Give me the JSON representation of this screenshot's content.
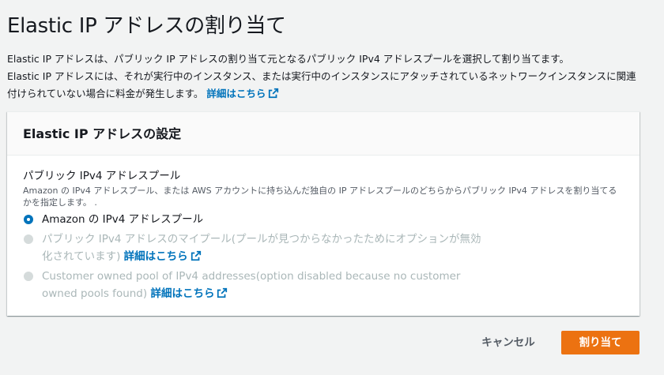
{
  "page": {
    "title": "Elastic IP アドレスの割り当て",
    "intro_line1": "Elastic IP アドレスは、パブリック IP アドレスの割り当て元となるパブリック IPv4 アドレスプールを選択して割り当てます。",
    "intro_line2": "Elastic IP アドレスには、それが実行中のインスタンス、または実行中のインスタンスにアタッチされているネットワークインスタンスに関連付けられていない場合に料金が発生します。",
    "learn_more": "詳細はこちら"
  },
  "panel": {
    "title": "Elastic IP アドレスの設定",
    "field_label": "パブリック IPv4 アドレスプール",
    "field_description": "Amazon の IPv4 アドレスプール、または AWS アカウントに持ち込んだ独自の IP アドレスプールのどちらからパブリック IPv4 アドレスを割り当てるかを指定します。 .",
    "options": [
      {
        "label": "Amazon の IPv4 アドレスプール",
        "selected": true,
        "disabled": false
      },
      {
        "label": "パブリック IPv4 アドレスのマイプール(プールが見つからなかったためにオプションが無効化されています)",
        "selected": false,
        "disabled": true,
        "link": "詳細はこちら"
      },
      {
        "label": "Customer owned pool of IPv4 addresses(option disabled because no customer owned pools found)",
        "selected": false,
        "disabled": true,
        "link": "詳細はこちら"
      }
    ]
  },
  "footer": {
    "cancel_label": "キャンセル",
    "submit_label": "割り当て"
  },
  "colors": {
    "accent": "#ec7211",
    "link": "#0073bb",
    "radio_selected": "#0073bb",
    "disabled_text": "#aab7b8",
    "background": "#f2f3f3"
  },
  "icons": [
    "external-link-icon",
    "radio-checked-icon",
    "radio-disabled-icon"
  ]
}
